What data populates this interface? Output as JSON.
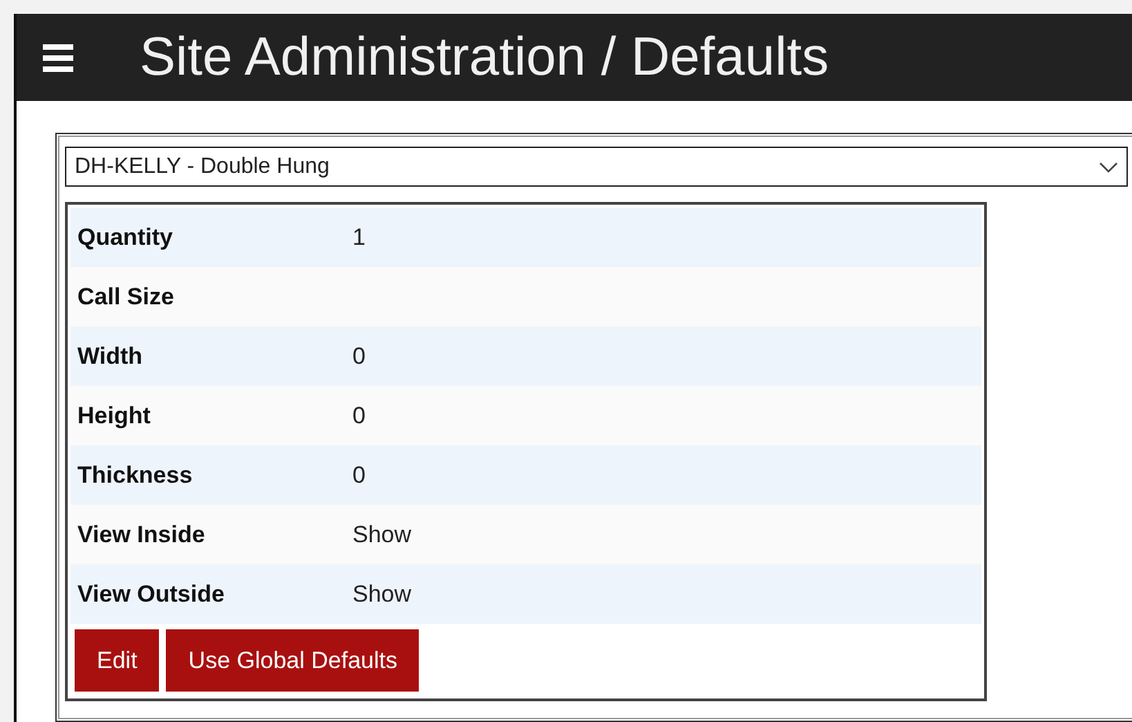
{
  "header": {
    "title": "Site Administration / Defaults"
  },
  "select": {
    "value": "DH-KELLY - Double Hung"
  },
  "rows": [
    {
      "label": "Quantity",
      "value": "1"
    },
    {
      "label": "Call Size"
    },
    {
      "label": "Width",
      "value": "0"
    },
    {
      "label": "Height",
      "value": "0"
    },
    {
      "label": "Thickness",
      "value": "0"
    },
    {
      "label": "View Inside",
      "value": "Show"
    },
    {
      "label": "View Outside",
      "value": "Show"
    }
  ],
  "buttons": [
    "Edit",
    "Use Global Defaults"
  ]
}
